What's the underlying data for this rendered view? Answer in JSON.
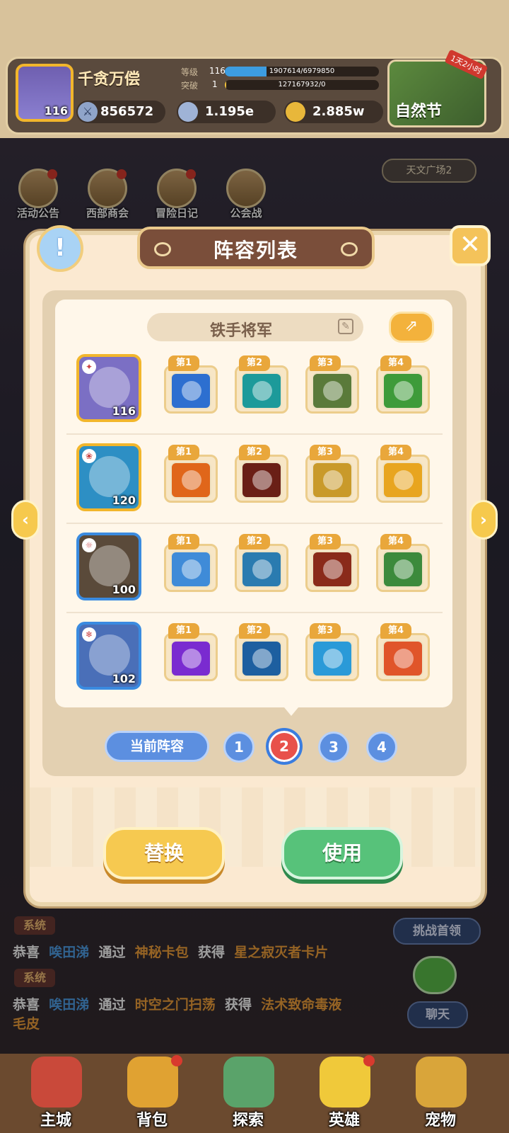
{
  "header": {
    "player_name": "千贪万偿",
    "player_level": "116",
    "power": "856572",
    "level_label": "等级",
    "level_value": "116",
    "level_progress": "1907614/6979850",
    "level_fill": 0.27,
    "break_label": "突破",
    "break_value": "1",
    "break_progress": "127167932/0",
    "break_fill": 0.01,
    "currency_gems": "1.195e",
    "currency_coins": "2.885w",
    "event_name": "自然节",
    "event_tag": "1天2小时"
  },
  "quick_icons": [
    {
      "label": "活动公告"
    },
    {
      "label": "西部商会"
    },
    {
      "label": "冒险日记"
    },
    {
      "label": "公会战"
    }
  ],
  "location": "天文广场2",
  "modal": {
    "title": "阵容列表",
    "team_name": "铁手将军",
    "heroes": [
      {
        "level": "116",
        "color": "#7b6fc4",
        "border": "#f2b62c",
        "element": "✦",
        "skills": [
          {
            "tab": "第1",
            "color": "#2d6fd0"
          },
          {
            "tab": "第2",
            "color": "#1c9a9a"
          },
          {
            "tab": "第3",
            "color": "#5a7a3a"
          },
          {
            "tab": "第4",
            "color": "#3e9b3a"
          }
        ]
      },
      {
        "level": "120",
        "color": "#2d8fc4",
        "border": "#f2b62c",
        "element": "❀",
        "skills": [
          {
            "tab": "第1",
            "color": "#e0661a"
          },
          {
            "tab": "第2",
            "color": "#6a1f16"
          },
          {
            "tab": "第3",
            "color": "#c99a2a"
          },
          {
            "tab": "第4",
            "color": "#e8a51f"
          }
        ]
      },
      {
        "level": "100",
        "color": "#5a4a3a",
        "border": "#3a8be0",
        "element": "☼",
        "skills": [
          {
            "tab": "第1",
            "color": "#3f8bd8"
          },
          {
            "tab": "第2",
            "color": "#2a7bb0"
          },
          {
            "tab": "第3",
            "color": "#8a2a1a"
          },
          {
            "tab": "第4",
            "color": "#3c8a3c"
          }
        ]
      },
      {
        "level": "102",
        "color": "#4a6fb8",
        "border": "#3a8be0",
        "element": "❄",
        "skills": [
          {
            "tab": "第1",
            "color": "#7a2bd0"
          },
          {
            "tab": "第2",
            "color": "#1d5fa0"
          },
          {
            "tab": "第3",
            "color": "#2a9ad8"
          },
          {
            "tab": "第4",
            "color": "#e0552a"
          }
        ]
      }
    ],
    "current_label": "当前阵容",
    "slots": [
      "1",
      "2",
      "3",
      "4"
    ],
    "active_slot": "2",
    "replace_label": "替换",
    "use_label": "使用"
  },
  "chat": [
    {
      "tag": "系统",
      "parts": [
        "恭喜",
        "唉田涕",
        "通过",
        "神秘卡包",
        "获得",
        "星之寂灭者卡片"
      ]
    },
    {
      "tag": "系统",
      "parts": [
        "恭喜",
        "唉田涕",
        "通过",
        "时空之门扫荡",
        "获得",
        "法术致命毒液",
        "毛皮"
      ]
    }
  ],
  "side": {
    "boss_label": "挑战首领",
    "chat_label": "聊天"
  },
  "nav": [
    {
      "label": "主城",
      "color": "#c9493a"
    },
    {
      "label": "背包",
      "color": "#e0a232"
    },
    {
      "label": "探索",
      "color": "#5aa36a"
    },
    {
      "label": "英雄",
      "color": "#f0c93a"
    },
    {
      "label": "宠物",
      "color": "#d9a53a"
    }
  ],
  "colors": {
    "accent_orange": "#f2b62c",
    "accent_blue": "#5c8fe0",
    "accent_red": "#e8514b",
    "use_green": "#57c27a"
  }
}
